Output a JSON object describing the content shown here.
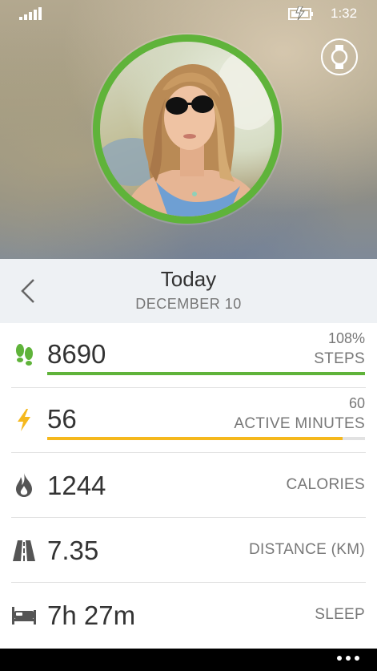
{
  "status_bar": {
    "time": "1:32"
  },
  "date_header": {
    "title": "Today",
    "subtitle": "DECEMBER 10"
  },
  "stats": [
    {
      "id": "steps",
      "icon": "footsteps-icon",
      "value": "8690",
      "goal": "108%",
      "label": "STEPS",
      "progress": 1.0,
      "color": "#5fb33a"
    },
    {
      "id": "active",
      "icon": "lightning-icon",
      "value": "56",
      "goal": "60",
      "label": "ACTIVE MINUTES",
      "progress": 0.93,
      "color": "#f5b81d"
    },
    {
      "id": "calories",
      "icon": "flame-icon",
      "value": "1244",
      "label": "CALORIES"
    },
    {
      "id": "distance",
      "icon": "road-icon",
      "value": "7.35",
      "label": "DISTANCE (KM)"
    },
    {
      "id": "sleep",
      "icon": "bed-icon",
      "value": "7h 27m",
      "label": "SLEEP"
    }
  ],
  "colors": {
    "accent_green": "#5fb33a",
    "accent_yellow": "#f5b81d"
  }
}
